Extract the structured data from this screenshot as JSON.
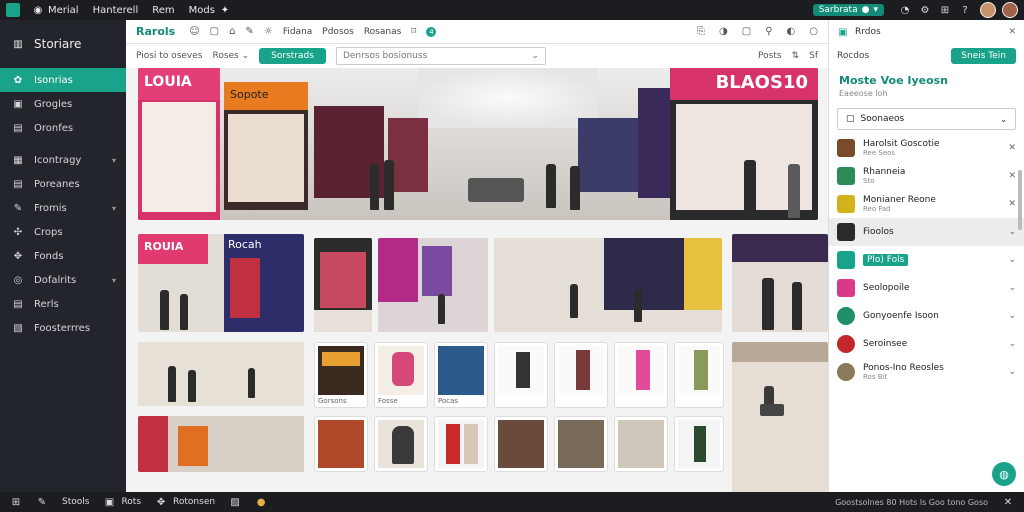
{
  "topbar": {
    "menu": [
      "Merial",
      "Hanterell",
      "Rem",
      "Mods"
    ],
    "status_pill": "Sarbrata",
    "status_icon": "check-icon",
    "icons": [
      "bell-icon",
      "gear-icon",
      "grid-icon",
      "help-icon",
      "close-icon"
    ]
  },
  "sidebar": {
    "header": "Storiare",
    "items": [
      {
        "label": "Isonrias",
        "icon": "store-icon",
        "active": true
      },
      {
        "label": "Grogles",
        "icon": "image-icon"
      },
      {
        "label": "Oronfes",
        "icon": "file-icon"
      },
      {
        "label": "Icontragy",
        "icon": "folder-icon",
        "chevron": true
      },
      {
        "label": "Poreanes",
        "icon": "list-icon"
      },
      {
        "label": "Fromis",
        "icon": "tag-icon",
        "chevron": true
      },
      {
        "label": "Crops",
        "icon": "crop-icon"
      },
      {
        "label": "Fonds",
        "icon": "people-icon"
      },
      {
        "label": "Dofalrits",
        "icon": "settings-icon",
        "chevron": true
      },
      {
        "label": "Rerls",
        "icon": "docs-icon"
      },
      {
        "label": "Foosterrres",
        "icon": "layers-icon"
      }
    ]
  },
  "toolbar": {
    "brand": "Rarols",
    "links": [
      "Fidana",
      "Pdosos",
      "Rosanas"
    ],
    "badge": "4",
    "right_icons": [
      "share-icon",
      "link-icon",
      "copy-icon",
      "pin-icon",
      "compare-icon",
      "info-icon"
    ]
  },
  "filterbar": {
    "filter1": "Piosi to oseves",
    "filter2": "Roses",
    "primary_button": "Sorstrads",
    "search_placeholder": "Denrsos bosionuss",
    "meta1": "Posts",
    "meta2": "Sf"
  },
  "gallery": {
    "hero_signs": [
      "LOUIA",
      "Sopote",
      "BLAOS10"
    ],
    "row2_signs": [
      "ROUIA",
      "Rocah"
    ],
    "product_captions": [
      "Gorsons",
      "Fosse",
      "Pocas",
      "",
      "",
      "",
      ""
    ]
  },
  "rpanel": {
    "header": "Rrdos",
    "row2_label": "Rocdos",
    "row2_button": "Sneis Tein",
    "title": "Moste Voe Iyeosn",
    "subtitle": "Eaeeose loh",
    "select_label": "Soonaeos",
    "items": [
      {
        "name": "Harolsit Goscotie",
        "sub": "Ree Seos",
        "color": "#7a4b2a",
        "end": "close-icon"
      },
      {
        "name": "Rhanneia",
        "sub": "Sto",
        "color": "#2e8b57",
        "end": "close-icon"
      },
      {
        "name": "Monianer Reone",
        "sub": "Reo Fad",
        "color": "#d4b21c",
        "end": "close-icon"
      },
      {
        "name": "Fioolos",
        "sub": "",
        "color": "#2a2a2a",
        "end": "chevron-down-icon",
        "selected": true
      },
      {
        "name": "Plo) Fols",
        "sub": "",
        "color": "#19a38a",
        "end": "chevron-down-icon",
        "highlight": true
      },
      {
        "name": "Seolopoile",
        "sub": "",
        "color": "#d83a8a",
        "end": "chevron-down-icon"
      },
      {
        "name": "Gonyoenfe Isoon",
        "sub": "",
        "color": "#1f8f6a",
        "end": "chevron-down-icon"
      },
      {
        "name": "Seroinsee",
        "sub": "",
        "color": "#c4262e",
        "end": "chevron-down-icon"
      },
      {
        "name": "Ponos-Ino Reosles",
        "sub": "Ros Bit",
        "color": "#8a7a5a",
        "end": "chevron-down-icon"
      }
    ]
  },
  "bottombar": {
    "items": [
      "Stools",
      "Rots",
      "Rotonsen"
    ],
    "right_text": "Goostsolnes 80 Hots ls Goo tono Goso"
  },
  "colors": {
    "accent": "#19a38a",
    "dark": "#1b1d21",
    "sidebar": "#22252b"
  }
}
